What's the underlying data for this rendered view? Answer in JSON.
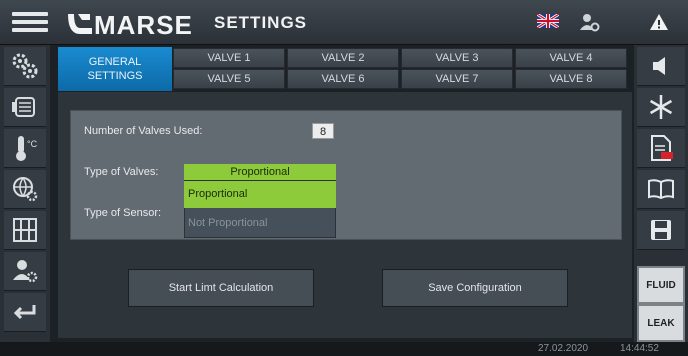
{
  "header": {
    "brand": "MARSE",
    "title": "SETTINGS"
  },
  "icons": {
    "menu": "hamburger-icon",
    "language": "uk-flag-icon",
    "user": "user-settings-icon",
    "alert": "warning-icon"
  },
  "left_sidebar": {
    "items": [
      {
        "icon": "gears-icon"
      },
      {
        "icon": "machine-icon"
      },
      {
        "icon": "thermometer-celsius-icon"
      },
      {
        "icon": "globe-gear-icon"
      },
      {
        "icon": "valves-icon"
      },
      {
        "icon": "users-gear-icon"
      },
      {
        "icon": "return-icon"
      }
    ]
  },
  "right_sidebar": {
    "items": [
      {
        "icon": "speaker-icon"
      },
      {
        "icon": "snowflake-icon"
      },
      {
        "icon": "pdf-document-icon"
      },
      {
        "icon": "book-icon"
      },
      {
        "icon": "save-icon"
      },
      {
        "label": "FLUID"
      },
      {
        "label": "LEAK"
      }
    ]
  },
  "tabs": {
    "general_line1": "GENERAL",
    "general_line2": "SETTINGS",
    "valves": [
      "VALVE 1",
      "VALVE 2",
      "VALVE 3",
      "VALVE 4",
      "VALVE 5",
      "VALVE 6",
      "VALVE 7",
      "VALVE 8"
    ]
  },
  "form": {
    "num_valves_label": "Number of Valves Used:",
    "num_valves_value": "8",
    "type_valves_label": "Type of Valves:",
    "type_valves_value": "Proportional",
    "type_sensor_label": "Type of Sensor:",
    "dropdown_options": [
      "Proportional",
      "Not Proportional"
    ]
  },
  "buttons": {
    "start_limit": "Start Limt Calculation",
    "save_config": "Save Configuration"
  },
  "status": {
    "date": "27.02.2020",
    "time": "14:44:52"
  },
  "colors": {
    "accent_blue": "#0d6aa8",
    "selected_green": "#8ecb3a",
    "background": "#1c2126"
  }
}
